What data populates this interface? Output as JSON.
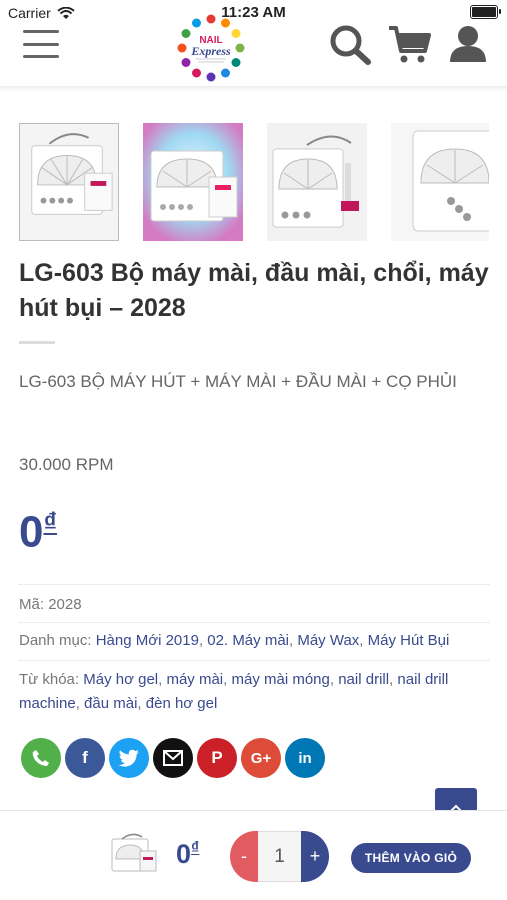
{
  "status_bar": {
    "carrier": "Carrier",
    "time": "11:23 AM"
  },
  "header": {
    "menu_icon": "hamburger-icon",
    "logo_text": "NAIL Express",
    "icons": [
      "search-icon",
      "cart-icon",
      "user-icon"
    ]
  },
  "gallery": {
    "thumb_count": 4,
    "active_index": 0
  },
  "product": {
    "title": "LG-603 Bộ máy mài, đầu mài, chổi, máy hút bụi – 2028",
    "description": "LG-603 BỘ MÁY HÚT + MÁY MÀI + ĐẦU MÀI + CỌ PHỦI",
    "rpm": "30.000 RPM",
    "price_value": "0",
    "currency": "₫",
    "sku_label": "Mã:",
    "sku": "2028",
    "category_label": "Danh mục:",
    "categories": [
      "Hàng Mới 2019",
      "02. Máy mài",
      "Máy Wax",
      "Máy Hút Bụi"
    ],
    "tag_label": "Từ khóa:",
    "tags": [
      "Máy hơ gel",
      "máy mài",
      "máy mài móng",
      "nail drill",
      "nail drill machine",
      "đầu mài",
      "đèn hơ gel"
    ]
  },
  "share": [
    {
      "name": "phone-icon",
      "color": "#51b04a"
    },
    {
      "name": "facebook-icon",
      "color": "#3b5998",
      "glyph": "f"
    },
    {
      "name": "twitter-icon",
      "color": "#1da1f2"
    },
    {
      "name": "email-icon",
      "color": "#111111"
    },
    {
      "name": "pinterest-icon",
      "color": "#cb2027",
      "glyph": "P"
    },
    {
      "name": "googleplus-icon",
      "color": "#dd4b39",
      "glyph": "G+"
    },
    {
      "name": "linkedin-icon",
      "color": "#0077b5",
      "glyph": "in"
    }
  ],
  "bottom_bar": {
    "price_value": "0",
    "currency": "₫",
    "minus": "-",
    "quantity": "1",
    "plus": "+",
    "add_to_cart": "THÊM VÀO GIỎ"
  },
  "colors": {
    "primary": "#3a4a8f",
    "minus": "#e25b60"
  }
}
